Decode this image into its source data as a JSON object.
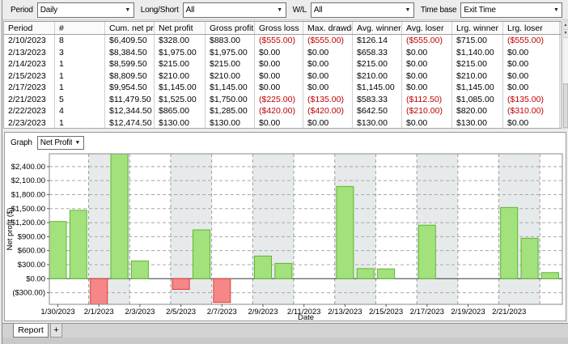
{
  "toolbar": {
    "period_label": "Period",
    "period_value": "Daily",
    "longshort_label": "Long/Short",
    "longshort_value": "All",
    "wl_label": "W/L",
    "wl_value": "All",
    "timebase_label": "Time base",
    "timebase_value": "Exit Time"
  },
  "table": {
    "columns": [
      "Period",
      "#",
      "Cum. net profit",
      "Net profit",
      "Gross profit",
      "Gross loss",
      "Max. drawdown",
      "Avg. winner",
      "Avg. loser",
      "Lrg. winner",
      "Lrg. loser"
    ],
    "rows": [
      [
        "2/10/2023",
        "8",
        "$6,409.50",
        "$328.00",
        "$883.00",
        "($555.00)",
        "($555.00)",
        "$126.14",
        "($555.00)",
        "$715.00",
        "($555.00)"
      ],
      [
        "2/13/2023",
        "3",
        "$8,384.50",
        "$1,975.00",
        "$1,975.00",
        "$0.00",
        "$0.00",
        "$658.33",
        "$0.00",
        "$1,140.00",
        "$0.00"
      ],
      [
        "2/14/2023",
        "1",
        "$8,599.50",
        "$215.00",
        "$215.00",
        "$0.00",
        "$0.00",
        "$215.00",
        "$0.00",
        "$215.00",
        "$0.00"
      ],
      [
        "2/15/2023",
        "1",
        "$8,809.50",
        "$210.00",
        "$210.00",
        "$0.00",
        "$0.00",
        "$210.00",
        "$0.00",
        "$210.00",
        "$0.00"
      ],
      [
        "2/17/2023",
        "1",
        "$9,954.50",
        "$1,145.00",
        "$1,145.00",
        "$0.00",
        "$0.00",
        "$1,145.00",
        "$0.00",
        "$1,145.00",
        "$0.00"
      ],
      [
        "2/21/2023",
        "5",
        "$11,479.50",
        "$1,525.00",
        "$1,750.00",
        "($225.00)",
        "($135.00)",
        "$583.33",
        "($112.50)",
        "$1,085.00",
        "($135.00)"
      ],
      [
        "2/22/2023",
        "4",
        "$12,344.50",
        "$865.00",
        "$1,285.00",
        "($420.00)",
        "($420.00)",
        "$642.50",
        "($210.00)",
        "$820.00",
        "($310.00)"
      ],
      [
        "2/23/2023",
        "1",
        "$12,474.50",
        "$130.00",
        "$130.00",
        "$0.00",
        "$0.00",
        "$130.00",
        "$0.00",
        "$130.00",
        "$0.00"
      ]
    ]
  },
  "graph": {
    "label": "Graph",
    "selected": "Net Profit"
  },
  "tabs": {
    "report": "Report",
    "add": "+"
  },
  "icons": {
    "dropdown_arrow": "▼",
    "scroll_up": "▲",
    "scroll_down": "▼"
  },
  "chart_data": {
    "type": "bar",
    "title": "",
    "xlabel": "Date",
    "ylabel": "Net profit ($)",
    "ylim": [
      -550,
      2675
    ],
    "grid": true,
    "y_ticks": [
      {
        "label": "$2,400.00",
        "value": 2400
      },
      {
        "label": "$2,100.00",
        "value": 2100
      },
      {
        "label": "$1,800.00",
        "value": 1800
      },
      {
        "label": "$1,500.00",
        "value": 1500
      },
      {
        "label": "$1,200.00",
        "value": 1200
      },
      {
        "label": "$900.00",
        "value": 900
      },
      {
        "label": "$600.00",
        "value": 600
      },
      {
        "label": "$300.00",
        "value": 300
      },
      {
        "label": "$0.00",
        "value": 0
      },
      {
        "label": "($300.00)",
        "value": -300
      }
    ],
    "x_ticks": [
      {
        "label": "1/30/2023",
        "day": 0
      },
      {
        "label": "2/1/2023",
        "day": 2
      },
      {
        "label": "2/3/2023",
        "day": 4
      },
      {
        "label": "2/5/2023",
        "day": 6
      },
      {
        "label": "2/7/2023",
        "day": 8
      },
      {
        "label": "2/9/2023",
        "day": 10
      },
      {
        "label": "2/11/2023",
        "day": 12
      },
      {
        "label": "2/13/2023",
        "day": 14
      },
      {
        "label": "2/15/2023",
        "day": 16
      },
      {
        "label": "2/17/2023",
        "day": 18
      },
      {
        "label": "2/19/2023",
        "day": 20
      },
      {
        "label": "2/21/2023",
        "day": 22
      }
    ],
    "bars": [
      {
        "date": "1/30/2023",
        "day": 0,
        "value": 1225
      },
      {
        "date": "1/31/2023",
        "day": 1,
        "value": 1465
      },
      {
        "date": "2/1/2023",
        "day": 2,
        "value": -555
      },
      {
        "date": "2/2/2023",
        "day": 3,
        "value": 2690
      },
      {
        "date": "2/3/2023",
        "day": 4,
        "value": 380
      },
      {
        "date": "2/5/2023",
        "day": 6,
        "value": -230
      },
      {
        "date": "2/6/2023",
        "day": 7,
        "value": 1045
      },
      {
        "date": "2/7/2023",
        "day": 8,
        "value": -510
      },
      {
        "date": "2/9/2023",
        "day": 10,
        "value": 485
      },
      {
        "date": "2/10/2023",
        "day": 11,
        "value": 328
      },
      {
        "date": "2/13/2023",
        "day": 14,
        "value": 1975
      },
      {
        "date": "2/14/2023",
        "day": 15,
        "value": 215
      },
      {
        "date": "2/15/2023",
        "day": 16,
        "value": 210
      },
      {
        "date": "2/17/2023",
        "day": 18,
        "value": 1145
      },
      {
        "date": "2/21/2023",
        "day": 22,
        "value": 1525
      },
      {
        "date": "2/22/2023",
        "day": 23,
        "value": 865
      },
      {
        "date": "2/23/2023",
        "day": 24,
        "value": 130
      }
    ],
    "bands": [
      [
        1.5,
        3.5
      ],
      [
        5.5,
        7.5
      ],
      [
        9.5,
        11.5
      ],
      [
        13.5,
        15.5
      ],
      [
        17.5,
        19.5
      ],
      [
        21.5,
        23.5
      ]
    ],
    "positive_color": "#a3e17d",
    "positive_border": "#5cb733",
    "negative_color": "#f58787",
    "negative_border": "#e03c3c",
    "band_color": "#e7eaea",
    "negative_text_color": "#c00000",
    "legend": "none"
  }
}
